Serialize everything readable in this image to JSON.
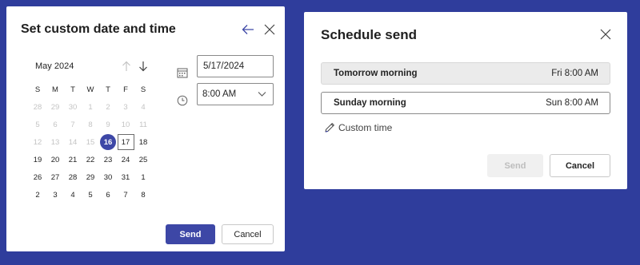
{
  "custom_dialog": {
    "title": "Set custom date and time",
    "calendar": {
      "month_label": "May 2024",
      "weekdays": [
        "S",
        "M",
        "T",
        "W",
        "T",
        "F",
        "S"
      ],
      "weeks": [
        [
          {
            "d": "28",
            "muted": true
          },
          {
            "d": "29",
            "muted": true
          },
          {
            "d": "30",
            "muted": true
          },
          {
            "d": "1",
            "muted": true
          },
          {
            "d": "2",
            "muted": true
          },
          {
            "d": "3",
            "muted": true
          },
          {
            "d": "4",
            "muted": true
          }
        ],
        [
          {
            "d": "5",
            "muted": true
          },
          {
            "d": "6",
            "muted": true
          },
          {
            "d": "7",
            "muted": true
          },
          {
            "d": "8",
            "muted": true
          },
          {
            "d": "9",
            "muted": true
          },
          {
            "d": "10",
            "muted": true
          },
          {
            "d": "11",
            "muted": true
          }
        ],
        [
          {
            "d": "12",
            "muted": true
          },
          {
            "d": "13",
            "muted": true
          },
          {
            "d": "14",
            "muted": true
          },
          {
            "d": "15",
            "muted": true
          },
          {
            "d": "16",
            "selected": true
          },
          {
            "d": "17",
            "today": true
          },
          {
            "d": "18"
          }
        ],
        [
          {
            "d": "19"
          },
          {
            "d": "20"
          },
          {
            "d": "21"
          },
          {
            "d": "22"
          },
          {
            "d": "23"
          },
          {
            "d": "24"
          },
          {
            "d": "25"
          }
        ],
        [
          {
            "d": "26"
          },
          {
            "d": "27"
          },
          {
            "d": "28"
          },
          {
            "d": "29"
          },
          {
            "d": "30"
          },
          {
            "d": "31"
          },
          {
            "d": "1"
          }
        ],
        [
          {
            "d": "2"
          },
          {
            "d": "3"
          },
          {
            "d": "4"
          },
          {
            "d": "5"
          },
          {
            "d": "6"
          },
          {
            "d": "7"
          },
          {
            "d": "8"
          }
        ]
      ]
    },
    "date_value": "5/17/2024",
    "time_value": "8:00 AM",
    "send_label": "Send",
    "cancel_label": "Cancel"
  },
  "schedule_dialog": {
    "title": "Schedule send",
    "options": [
      {
        "label": "Tomorrow morning",
        "time": "Fri 8:00 AM"
      },
      {
        "label": "Sunday morning",
        "time": "Sun 8:00 AM"
      }
    ],
    "custom_time_label": "Custom time",
    "send_label": "Send",
    "cancel_label": "Cancel"
  },
  "colors": {
    "background": "#2f3d9c",
    "accent": "#3d47a6",
    "muted_text": "#c4c4c4"
  }
}
